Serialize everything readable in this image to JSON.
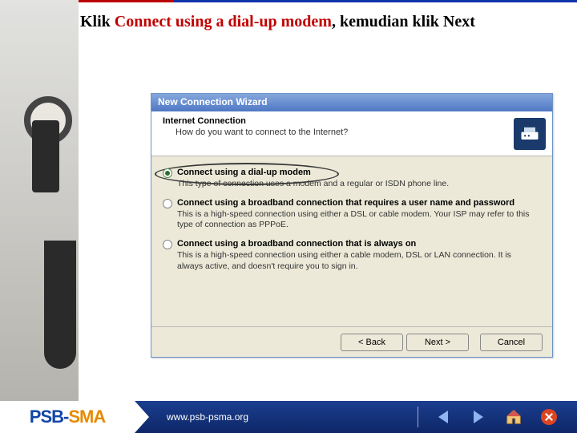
{
  "instruction": {
    "prefix": "Klik ",
    "highlight": "Connect using a dial-up modem",
    "middle": ", kemudian klik ",
    "suffix": "Next"
  },
  "wizard": {
    "title": "New Connection Wizard",
    "header_title": "Internet Connection",
    "header_sub": "How do you want to connect to the Internet?",
    "options": [
      {
        "label": "Connect using a dial-up modem",
        "desc": "This type of connection uses a modem and a regular or ISDN phone line.",
        "selected": true
      },
      {
        "label": "Connect using a broadband connection that requires a user name and password",
        "desc": "This is a high-speed connection using either a DSL or cable modem. Your ISP may refer to this type of connection as PPPoE.",
        "selected": false
      },
      {
        "label": "Connect using a broadband connection that is always on",
        "desc": "This is a high-speed connection using either a cable modem, DSL or LAN connection. It is always active, and doesn't require you to sign in.",
        "selected": false
      }
    ],
    "buttons": {
      "back": "< Back",
      "next": "Next >",
      "cancel": "Cancel"
    }
  },
  "footer": {
    "logo_left": "PSB-",
    "logo_right": "SMA",
    "url": "www.psb-psma.org"
  }
}
